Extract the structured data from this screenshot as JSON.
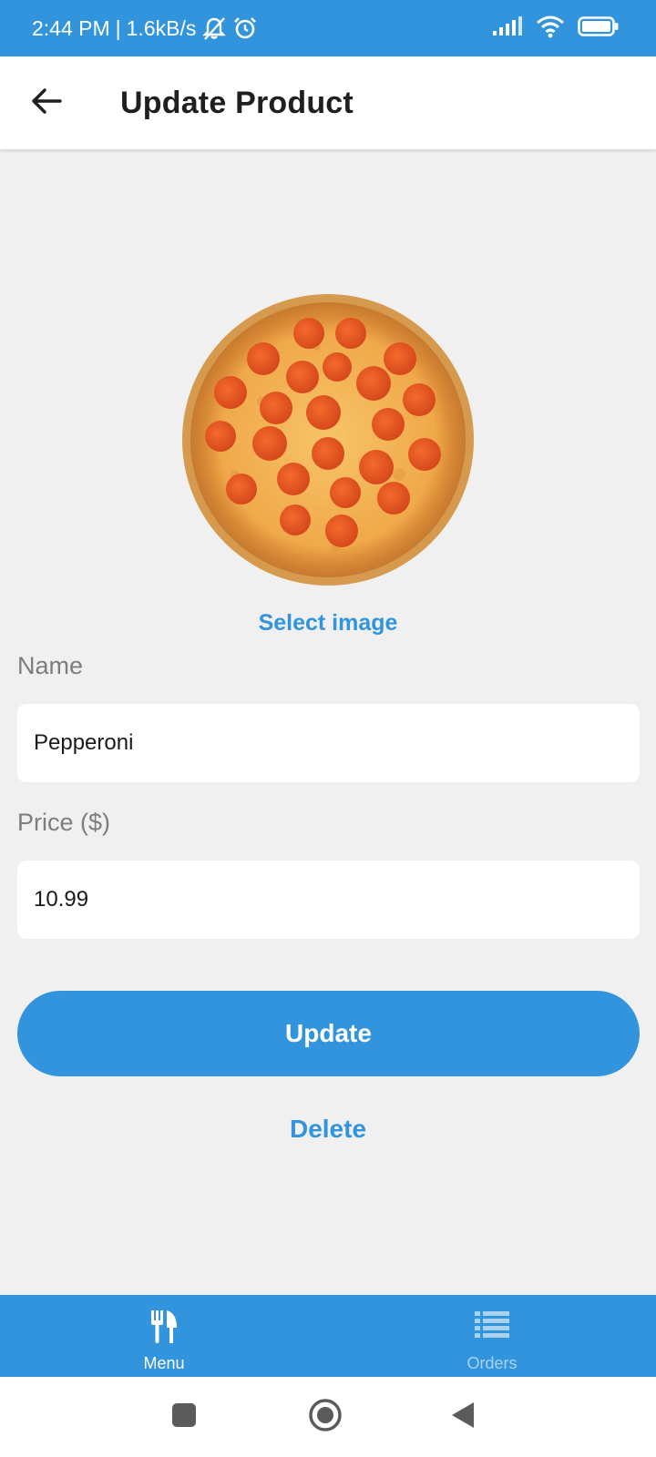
{
  "status_bar": {
    "time": "2:44 PM",
    "separator": "|",
    "net_speed": "1.6kB/s",
    "icons": [
      "mute-notifications-icon",
      "alarm-icon",
      "signal-icon",
      "wifi-icon",
      "battery-icon"
    ]
  },
  "app_bar": {
    "title": "Update Product",
    "back_icon": "arrow-left-icon"
  },
  "product": {
    "image_icon": "pepperoni-pizza-image",
    "select_image_label": "Select image"
  },
  "form": {
    "name": {
      "label": "Name",
      "value": "Pepperoni"
    },
    "price": {
      "label": "Price ($)",
      "value": "10.99"
    }
  },
  "actions": {
    "update_label": "Update",
    "delete_label": "Delete"
  },
  "bottom_nav": {
    "tabs": [
      {
        "label": "Menu",
        "icon": "fork-knife-icon",
        "active": true
      },
      {
        "label": "Orders",
        "icon": "list-icon",
        "active": false
      }
    ]
  },
  "system_nav": {
    "icons": [
      "recents-square-icon",
      "home-circle-icon",
      "back-triangle-icon"
    ]
  },
  "colors": {
    "accent": "#3194dc",
    "background": "#f0f0f0",
    "inactive_tab": "#a9d2f1"
  }
}
